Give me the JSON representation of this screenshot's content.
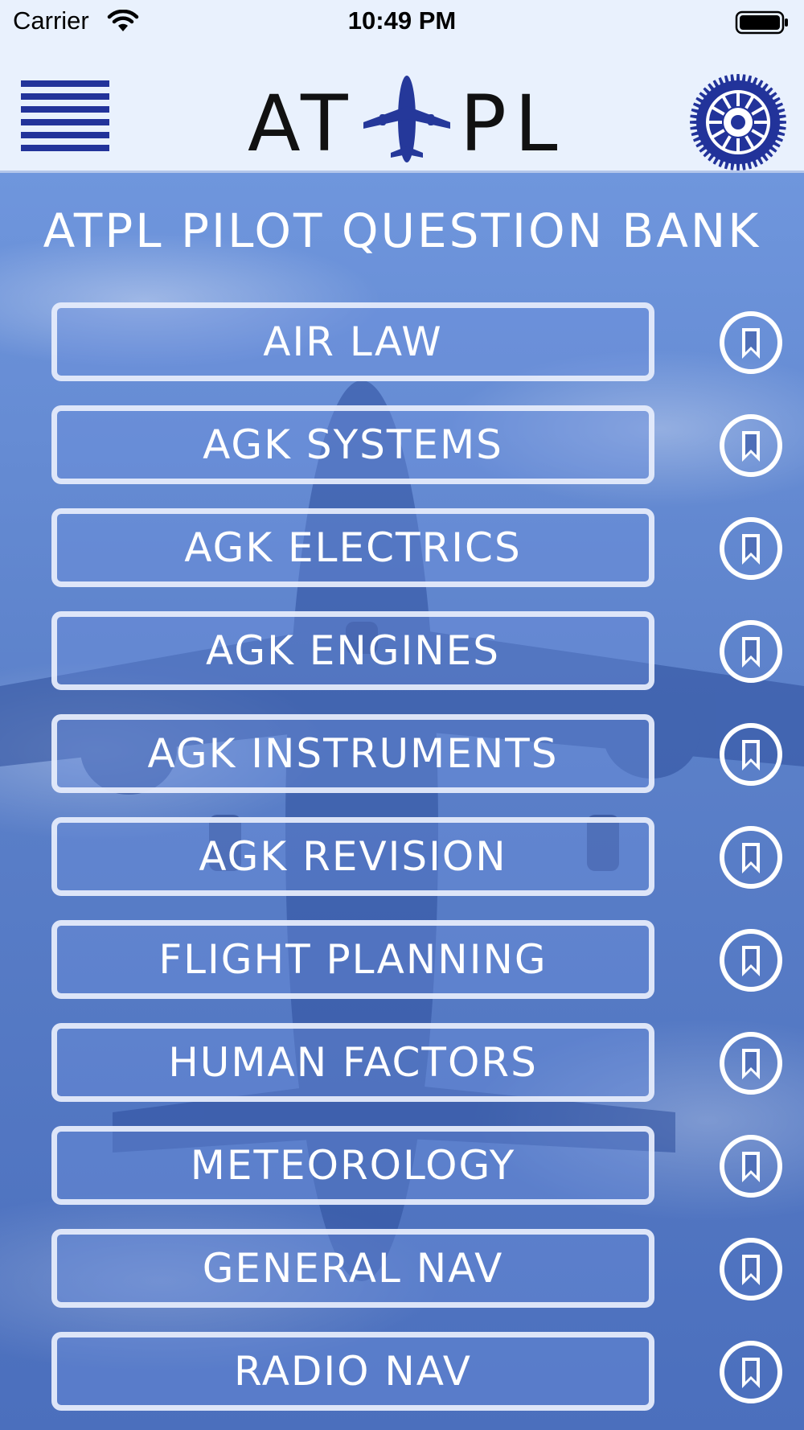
{
  "status_bar": {
    "carrier": "Carrier",
    "time": "10:49 PM"
  },
  "nav_bar": {
    "logo_letters": [
      "A",
      "T",
      "P",
      "L"
    ],
    "menu_icon": "hamburger-menu-icon",
    "settings_icon": "gear-icon",
    "logo_icon": "airplane-icon"
  },
  "main": {
    "title": "ATPL PILOT QUESTION BANK",
    "subjects": [
      {
        "label": "AIR LAW"
      },
      {
        "label": "AGK SYSTEMS"
      },
      {
        "label": "AGK ELECTRICS"
      },
      {
        "label": "AGK ENGINES"
      },
      {
        "label": "AGK INSTRUMENTS"
      },
      {
        "label": "AGK REVISION"
      },
      {
        "label": "FLIGHT PLANNING"
      },
      {
        "label": "HUMAN FACTORS"
      },
      {
        "label": "METEOROLOGY"
      },
      {
        "label": "GENERAL NAV"
      },
      {
        "label": "RADIO NAV"
      }
    ],
    "bookmark_icon": "bookmark-icon"
  },
  "colors": {
    "nav_background": "#e9f1fd",
    "accent": "#22339a",
    "sky": "#5f86cf",
    "button_border": "#e8eefc"
  }
}
